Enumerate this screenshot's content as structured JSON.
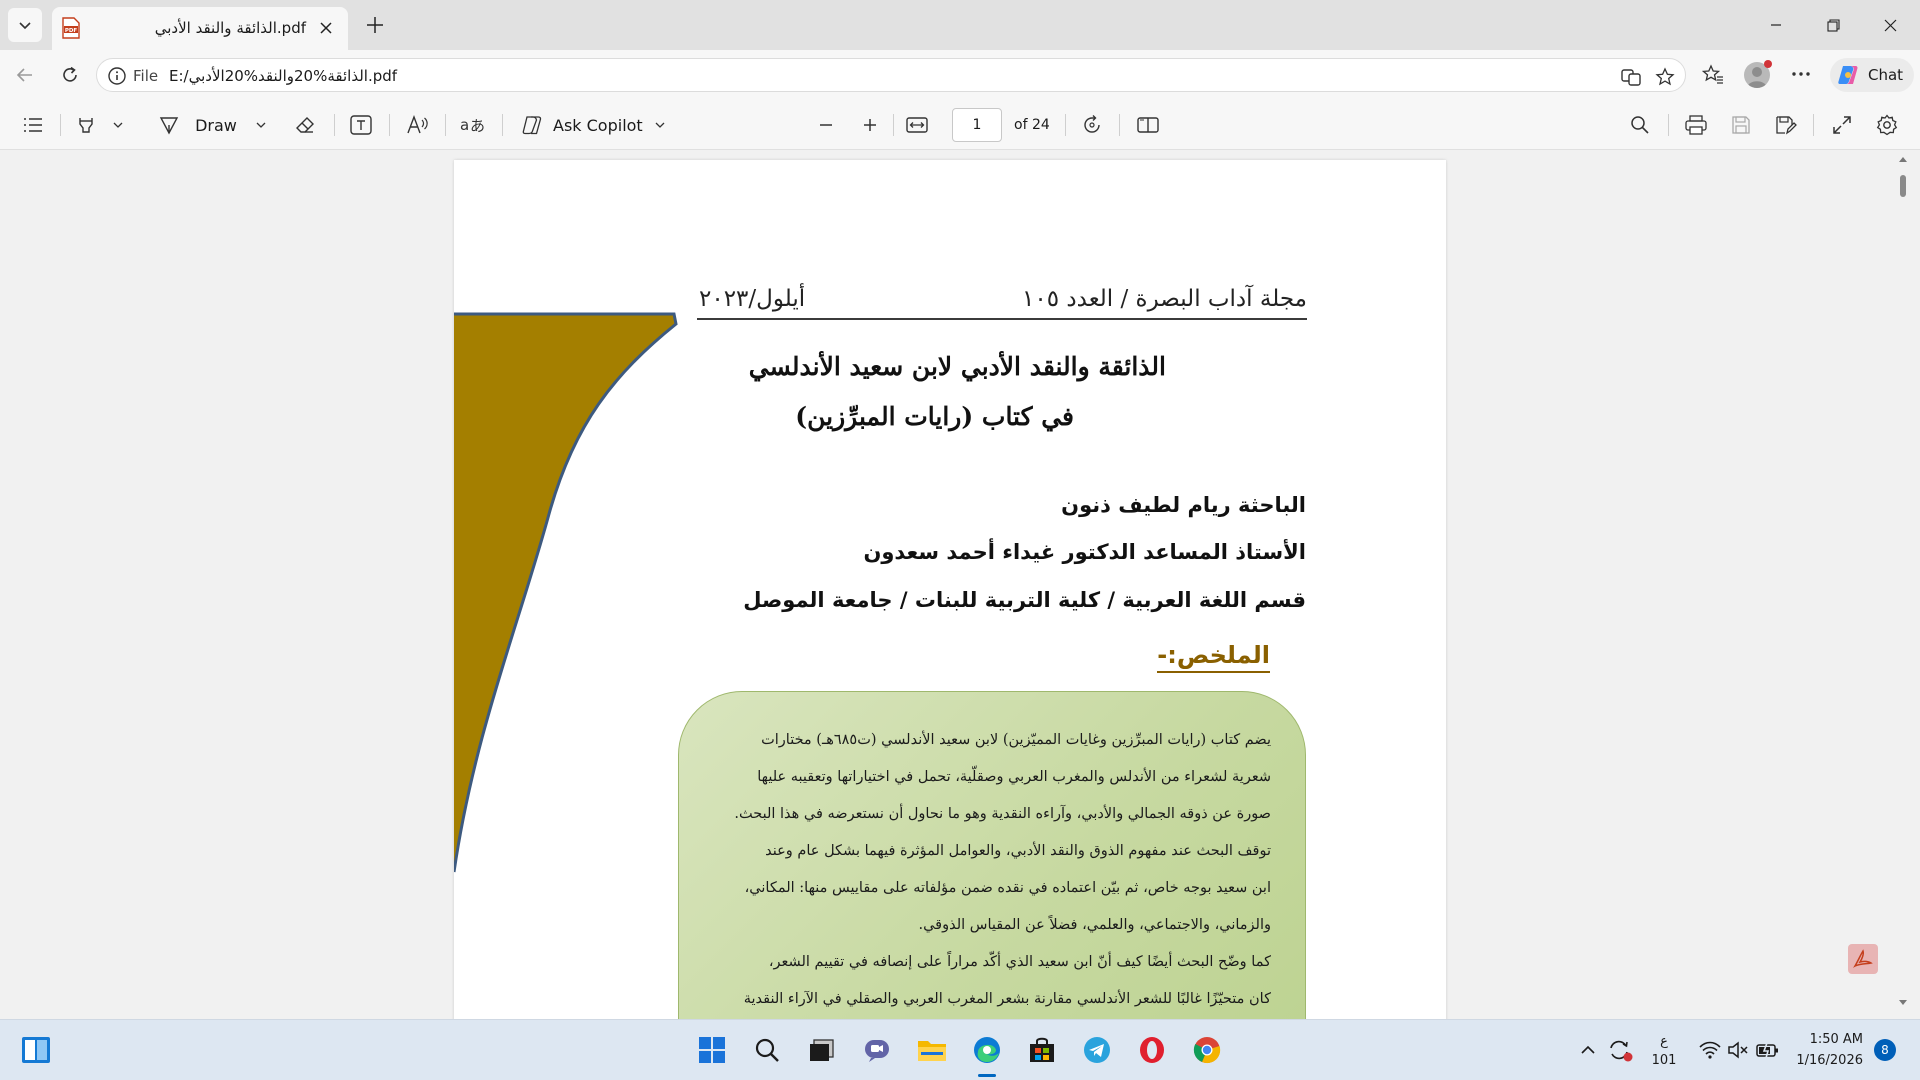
{
  "browser": {
    "tab": {
      "title": "الذائقة والنقد الأدبي.pdf",
      "favicon": "pdf-icon"
    },
    "address": {
      "scheme": "File",
      "url": "E:/الذائقة%20والنقد%20الأدبي.pdf"
    },
    "chat_label": "Chat"
  },
  "pdf_toolbar": {
    "draw_label": "Draw",
    "copilot_label": "Ask Copilot",
    "page_number": "1",
    "page_total": "of 24"
  },
  "document": {
    "journal_name": "مجلة آداب البصرة / العدد ١٠٥",
    "journal_date": "أيلول/٢٠٢٣",
    "title_line1": "الذائقة والنقد الأدبي لابن سعيد الأندلسي",
    "title_line2": "في كتاب (رايات المبرِّزين)",
    "author1": "الباحثة ريام لطيف ذنون",
    "author2": "الأستاذ المساعد الدكتور غيداء أحمد سعدون",
    "affiliation": "قسم اللغة العربية / كلية التربية للبنات / جامعة الموصل",
    "abstract_heading": "الملخص:-",
    "abstract_lines": [
      "يضم كتاب (رايات المبرِّزين وغايات المميّزين) لابن سعيد الأندلسي (ت٦٨٥هـ) مختارات",
      "شعرية لشعراء من الأندلس والمغرب العربي وصقلّية، تحمل في اختياراتها وتعقيبه عليها",
      "صورة عن ذوقه الجمالي والأدبي، وآراءه النقدية وهو ما نحاول أن نستعرضه في هذا البحث.",
      "توقف البحث عند مفهوم الذوق والنقد الأدبي، والعوامل المؤثرة فيهما بشكل عام وعند",
      "ابن سعيد بوجه خاص، ثم بيّن اعتماده في نقده ضمن مؤلفاته على مقاييس منها: المكاني،",
      "والزماني، والاجتماعي، والعلمي، فضلاً عن المقياس الذوقي.",
      "كما وضّح البحث أيضًا كيف أنّ ابن سعيد الذي أكّد مراراً على إنصافه في تقييم الشعر،",
      "كان متحيّزًا غالبًا للشعر الأندلسي مقارنة بشعر المغرب العربي والصقلي في الآراء النقدية"
    ]
  },
  "taskbar": {
    "lang_line1": "ع",
    "lang_line2": "101",
    "time": "1:50 AM",
    "date": "1/16/2026",
    "notification_count": "8"
  },
  "colors": {
    "accent": "#0067c0",
    "page_ribbon": "#a47f00",
    "ribbon_edge": "#3d5a80",
    "abstract_bg": "#c7d9a1",
    "abstract_heading": "#8a6000"
  }
}
